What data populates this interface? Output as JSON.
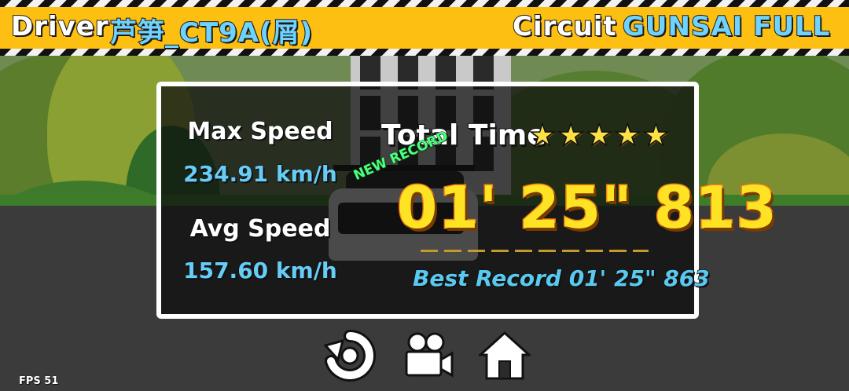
{
  "header": {
    "driver_label": "Driver",
    "driver_name": "芦笋_CT9A(屑)",
    "circuit_label": "Circuit",
    "circuit_name": "GUNSAI FULL"
  },
  "results": {
    "max_speed_label": "Max Speed",
    "max_speed_value": "234.91 km/h",
    "avg_speed_label": "Avg Speed",
    "avg_speed_value": "157.60 km/h",
    "total_time_label": "Total Time",
    "stars": {
      "rating": 5,
      "max": 5,
      "glyphs": [
        "★",
        "★",
        "★",
        "★",
        "★"
      ]
    },
    "new_record_label": "NEW RECORD",
    "total_time": "01' 25\" 813",
    "best_record": "Best Record 01' 25\" 863"
  },
  "buttons": [
    {
      "name": "restart-icon"
    },
    {
      "name": "replay-camera-icon"
    },
    {
      "name": "home-icon"
    }
  ],
  "fps": "FPS 51",
  "colors": {
    "banner_yellow": "#fdbf12",
    "value_blue": "#67cdf6",
    "time_yellow": "#fde323",
    "time_outline": "#ee7d13",
    "new_record_green": "#4cff7c"
  }
}
